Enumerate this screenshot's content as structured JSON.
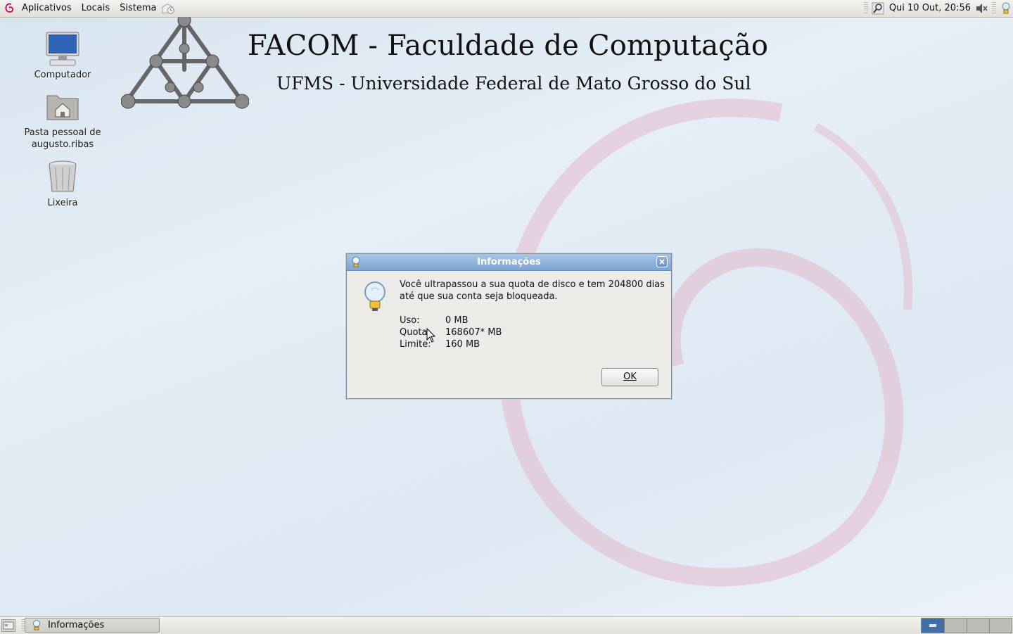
{
  "top_panel": {
    "menus": [
      "Aplicativos",
      "Locais",
      "Sistema"
    ],
    "clock": "Qui 10 Out, 20:56",
    "icons": [
      "debian-swirl-icon",
      "mail-clock-icon",
      "search-icon",
      "volume-icon",
      "lightbulb-icon"
    ]
  },
  "wallpaper": {
    "title": "FACOM - Faculdade de Computação",
    "subtitle": "UFMS - Universidade Federal de Mato Grosso do Sul"
  },
  "desktop_icons": [
    {
      "label": "Computador",
      "icon": "computer-icon"
    },
    {
      "label": "Pasta pessoal de augusto.ribas",
      "icon": "home-folder-icon"
    },
    {
      "label": "Lixeira",
      "icon": "trash-icon"
    }
  ],
  "dialog": {
    "title": "Informações",
    "message": "Você ultrapassou a sua quota de disco e tem 204800 dias até que sua conta seja bloqueada.",
    "rows": [
      {
        "key": "Uso:",
        "value": "0 MB"
      },
      {
        "key": "Quota:",
        "value": "168607* MB"
      },
      {
        "key": "Limite:",
        "value": "160 MB"
      }
    ],
    "ok_label": "OK"
  },
  "bottom_panel": {
    "task_label": "Informações",
    "workspaces_count": 4,
    "active_workspace": 1
  },
  "colors": {
    "titlebar": "#7ea4d0",
    "active_workspace": "#3f6ea8",
    "swirl": "#c8004f"
  }
}
